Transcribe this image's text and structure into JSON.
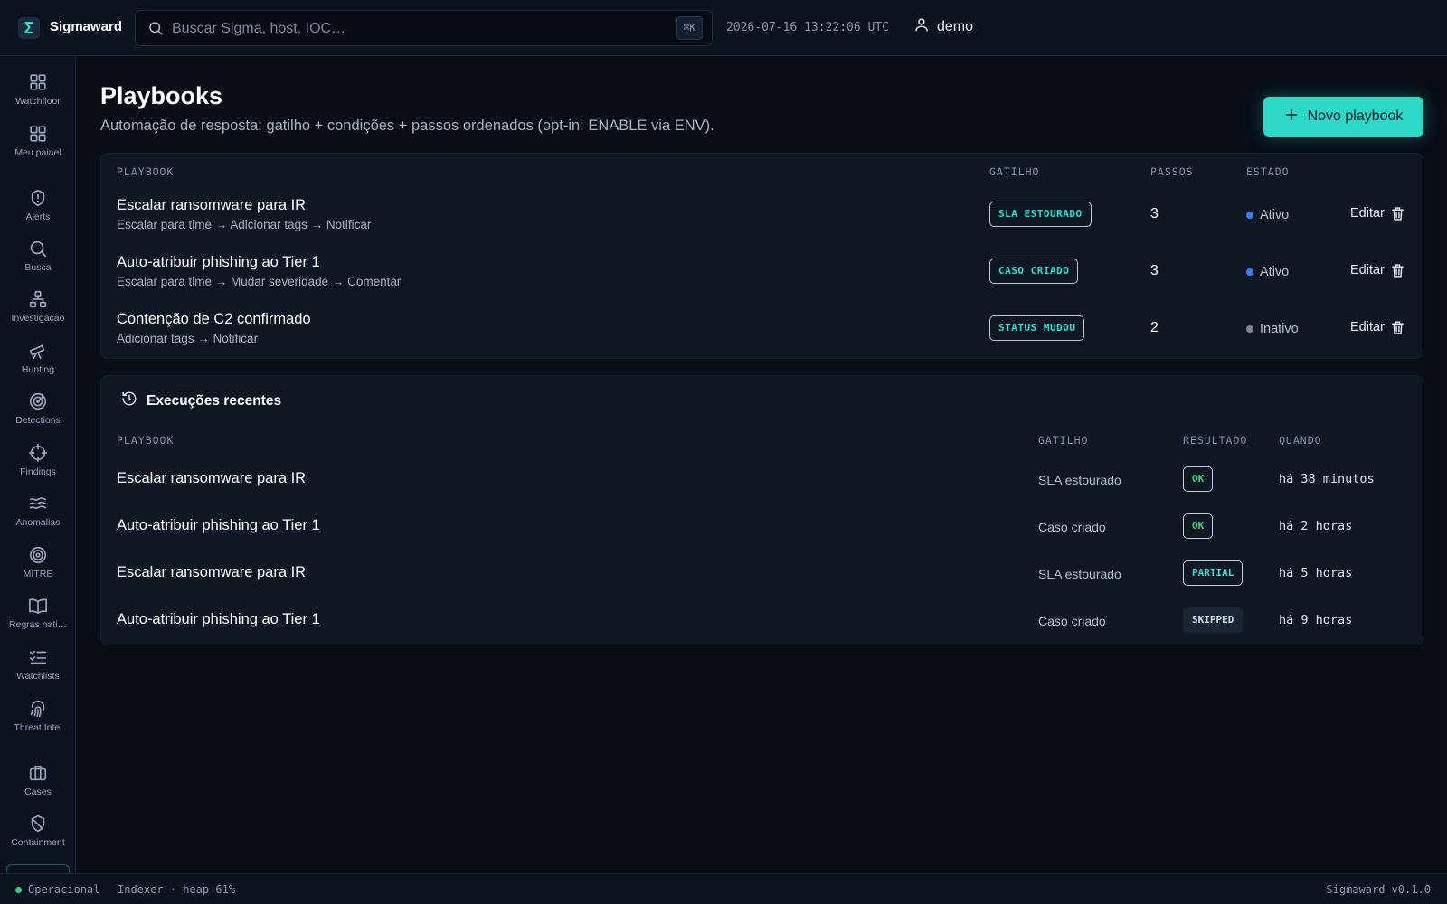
{
  "app": {
    "brand": "Sigmaward",
    "logo_glyph": "Σ",
    "accent_color": "#2ed8c9"
  },
  "topbar": {
    "search_placeholder": "Buscar Sigma, host, IOC…",
    "shortcut": "⌘K",
    "clock": "2026-07-16 13:22:06 UTC",
    "user": "demo"
  },
  "sidebar": {
    "items": [
      {
        "label": "Watchfloor",
        "icon": "grid-icon"
      },
      {
        "label": "Meu painel",
        "icon": "grid-icon"
      },
      {
        "label": "Alerts",
        "icon": "shield-alert-icon"
      },
      {
        "label": "Busca",
        "icon": "search-icon"
      },
      {
        "label": "Investigação",
        "icon": "network-icon"
      },
      {
        "label": "Hunting",
        "icon": "telescope-icon"
      },
      {
        "label": "Detections",
        "icon": "radar-icon"
      },
      {
        "label": "Findings",
        "icon": "crosshair-icon"
      },
      {
        "label": "Anomalias",
        "icon": "waves-icon"
      },
      {
        "label": "MITRE",
        "icon": "target-icon"
      },
      {
        "label": "Regras nati…",
        "icon": "book-icon"
      },
      {
        "label": "Watchlists",
        "icon": "list-checks-icon"
      },
      {
        "label": "Threat Intel",
        "icon": "fingerprint-icon"
      },
      {
        "label": "Cases",
        "icon": "briefcase-icon"
      },
      {
        "label": "Containment",
        "icon": "shield-off-icon"
      }
    ]
  },
  "page": {
    "title": "Playbooks",
    "subtitle": "Automação de resposta: gatilho + condições + passos ordenados (opt-in: ENABLE via ENV).",
    "new_button": "Novo playbook"
  },
  "playbooks": {
    "headers": {
      "playbook": "PLAYBOOK",
      "trigger": "GATILHO",
      "steps": "PASSOS",
      "state": "ESTADO"
    },
    "edit_label": "Editar",
    "rows": [
      {
        "name": "Escalar ransomware para IR",
        "steps_desc": "Escalar para time → Adicionar tags → Notificar",
        "trigger": "SLA ESTOURADO",
        "steps": "3",
        "state": "Ativo",
        "state_color": "#3b82f6"
      },
      {
        "name": "Auto-atribuir phishing ao Tier 1",
        "steps_desc": "Escalar para time → Mudar severidade → Comentar",
        "trigger": "CASO CRIADO",
        "steps": "3",
        "state": "Ativo",
        "state_color": "#3b82f6"
      },
      {
        "name": "Contenção de C2 confirmado",
        "steps_desc": "Adicionar tags → Notificar",
        "trigger": "STATUS MUDOU",
        "steps": "2",
        "state": "Inativo",
        "state_color": "#7d8898"
      }
    ]
  },
  "executions": {
    "title": "Execuções recentes",
    "headers": {
      "playbook": "PLAYBOOK",
      "trigger": "GATILHO",
      "result": "RESULTADO",
      "when": "QUANDO"
    },
    "rows": [
      {
        "name": "Escalar ransomware para IR",
        "trigger": "SLA estourado",
        "result": "OK",
        "result_kind": "ok",
        "when": "há 38 minutos"
      },
      {
        "name": "Auto-atribuir phishing ao Tier 1",
        "trigger": "Caso criado",
        "result": "OK",
        "result_kind": "ok",
        "when": "há 2 horas"
      },
      {
        "name": "Escalar ransomware para IR",
        "trigger": "SLA estourado",
        "result": "PARTIAL",
        "result_kind": "partial",
        "when": "há 5 horas"
      },
      {
        "name": "Auto-atribuir phishing ao Tier 1",
        "trigger": "Caso criado",
        "result": "SKIPPED",
        "result_kind": "skipped",
        "when": "há 9 horas"
      }
    ]
  },
  "statusbar": {
    "status": "Operacional",
    "indexer": "Indexer · heap 61%",
    "version": "Sigmaward v0.1.0",
    "status_color": "#36d27a"
  }
}
